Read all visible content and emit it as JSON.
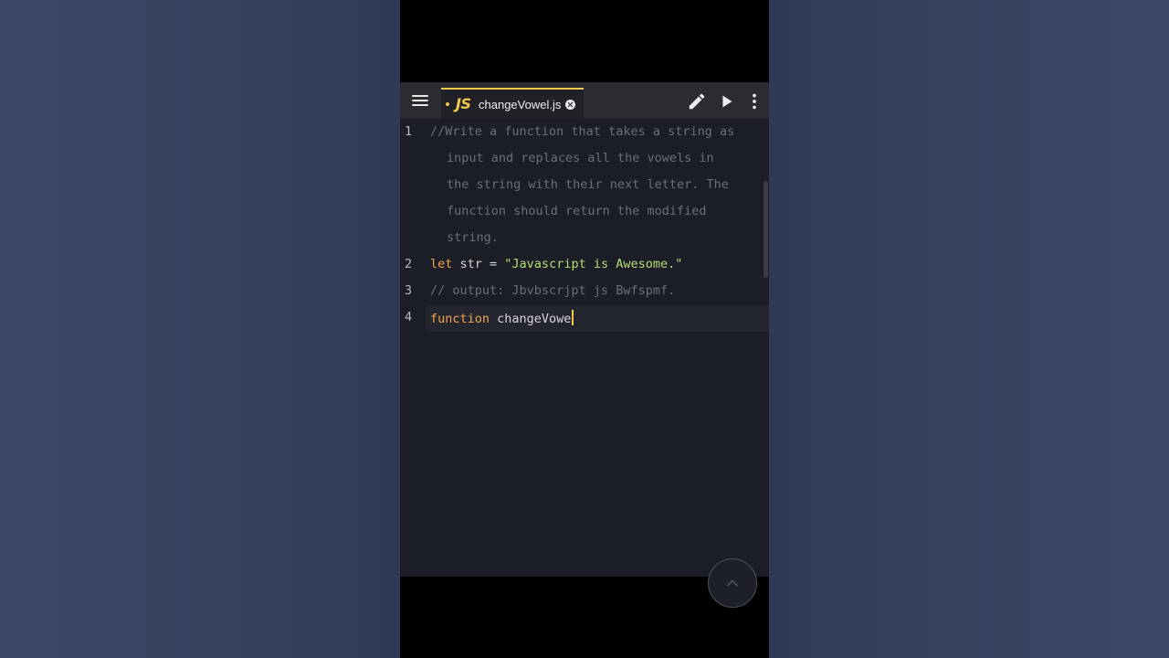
{
  "toolbar": {
    "menu_icon": "hamburger-menu-icon",
    "tab": {
      "lang_badge": "JS",
      "file_name": "changeVowel.js",
      "close_icon": "close-circle-icon",
      "modified": true
    },
    "edit_icon": "pencil-icon",
    "run_icon": "play-icon",
    "more_icon": "more-vertical-icon",
    "accent_color": "#f2c94c"
  },
  "editor": {
    "lines": [
      {
        "number": "1",
        "segments": [
          "//Write a function that takes a string as",
          "input and replaces all the vowels in",
          "the string with their next letter. The",
          "function should return the modified",
          "string."
        ]
      },
      {
        "number": "2",
        "keyword": "let",
        "ident": " str = ",
        "string": "\"Javascript is Awesome.\""
      },
      {
        "number": "3",
        "comment": "// output: Jbvbscrjpt js Bwfspmf."
      },
      {
        "number": "4",
        "keyword": "function",
        "ident": " changeVowe"
      }
    ],
    "colors": {
      "comment": "#6c6f76",
      "keyword": "#f5a44b",
      "string": "#b6df73",
      "identifier": "#d8d8d8",
      "background": "#1b1e26"
    }
  },
  "scroll_top_icon": "chevron-up-icon"
}
